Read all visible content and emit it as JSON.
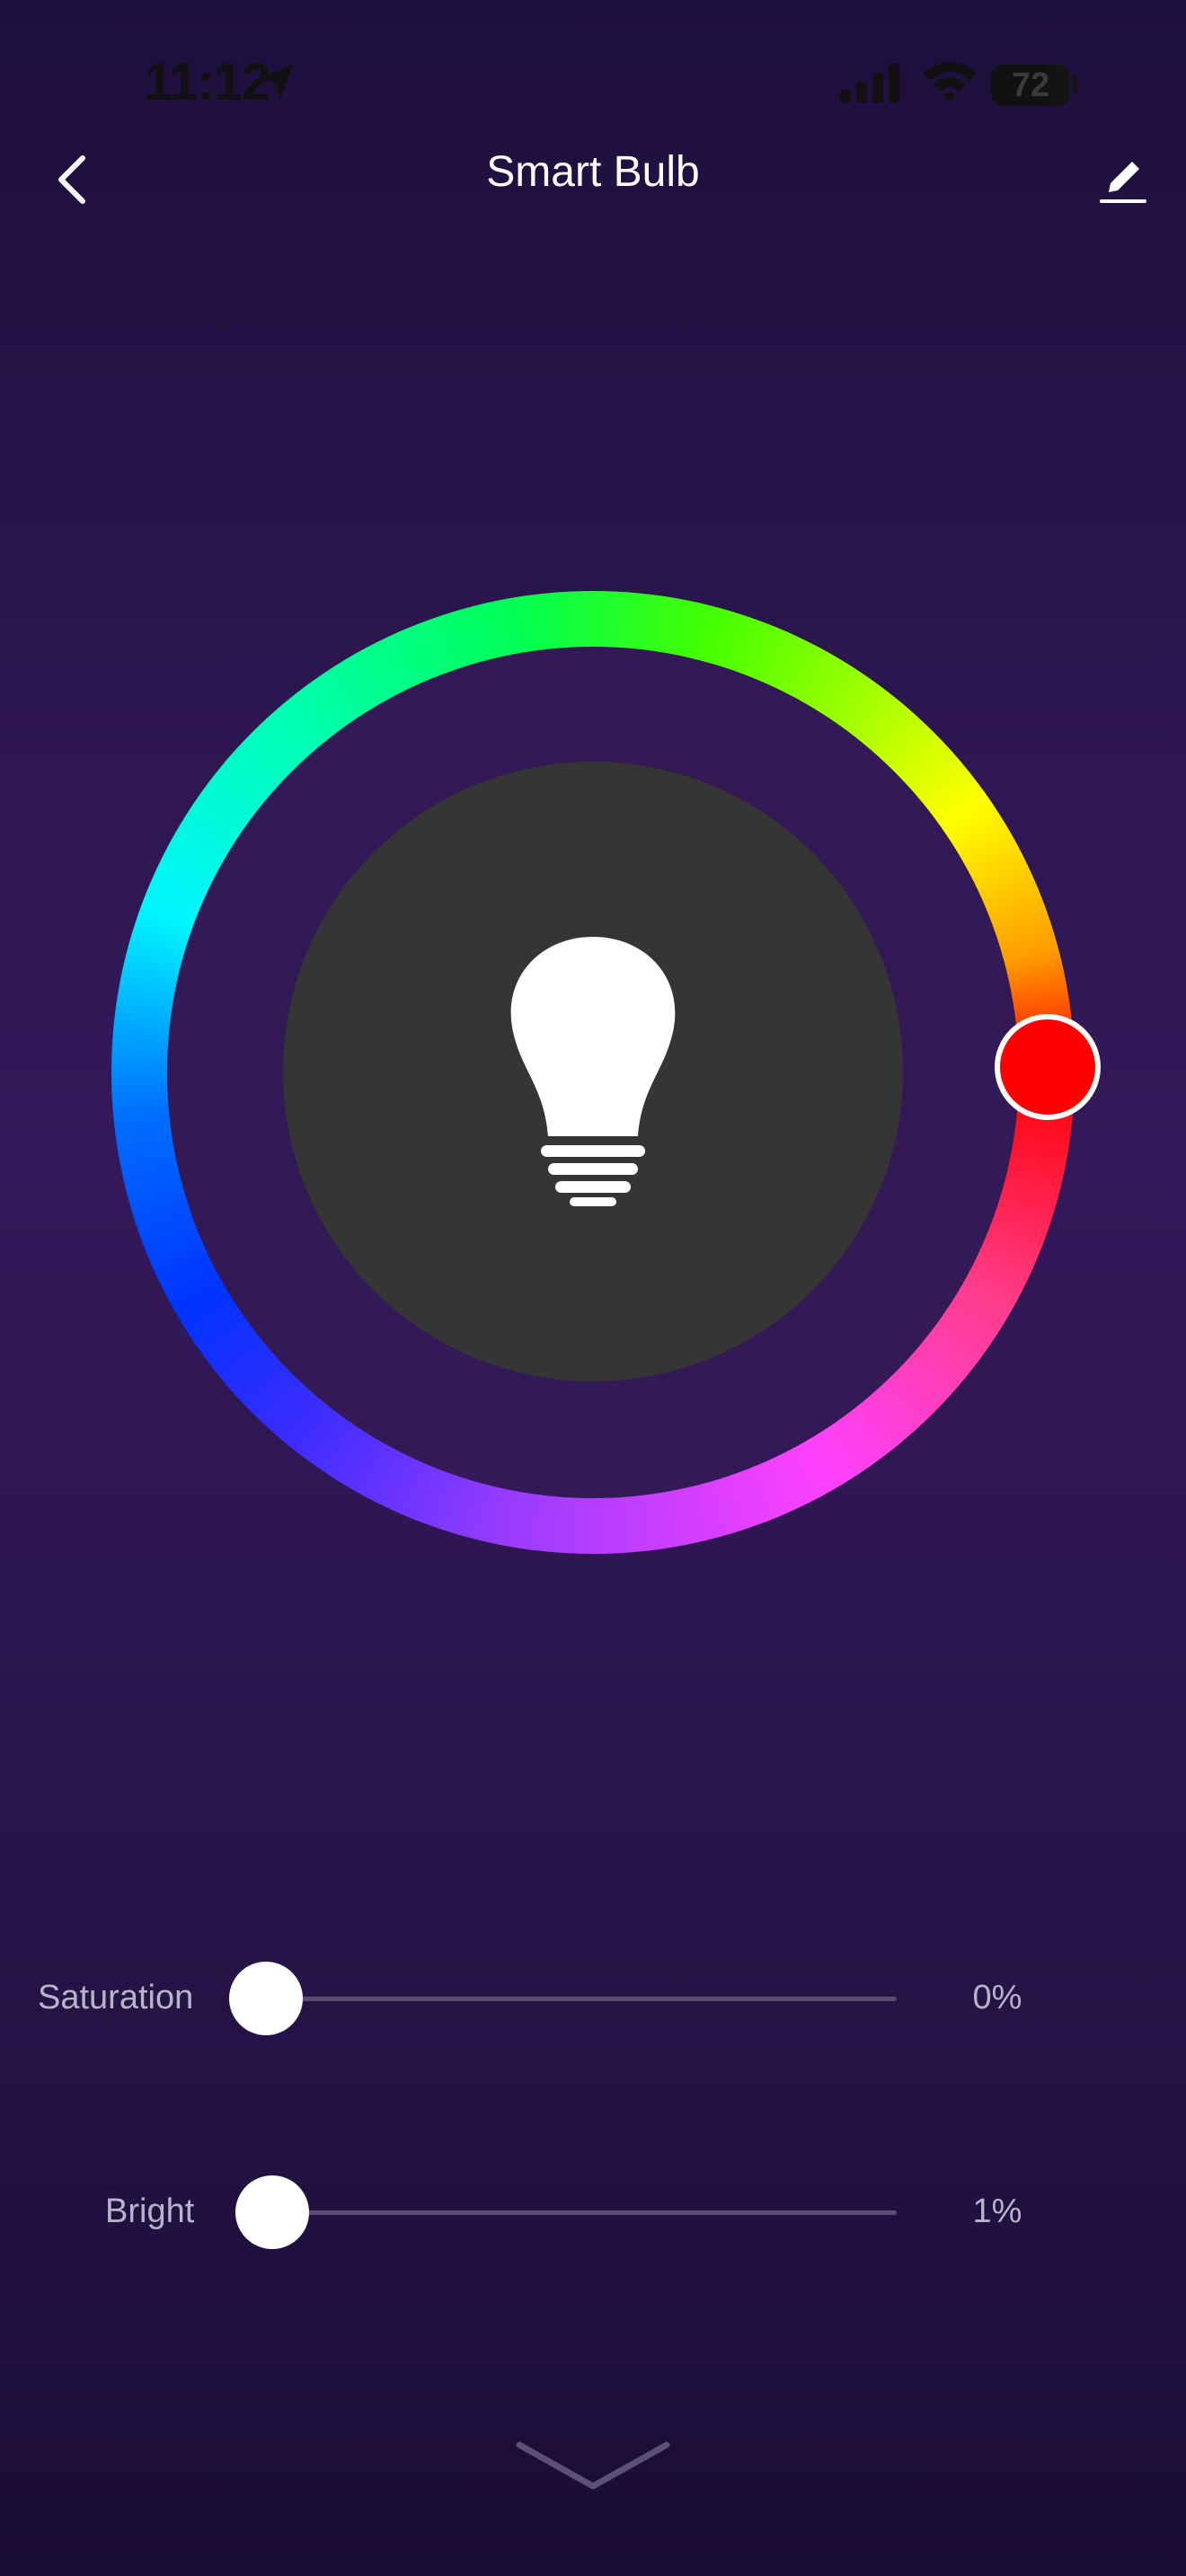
{
  "status_bar": {
    "time": "11:12",
    "battery": "72",
    "battery_level": 0.72,
    "icons": [
      "location-arrow-icon",
      "cellular-signal-icon",
      "wifi-icon",
      "battery-icon"
    ]
  },
  "header": {
    "title": "Smart Bulb",
    "back_icon": "chevron-left-icon",
    "edit_icon": "pencil-icon"
  },
  "color_wheel": {
    "selected_color": "#ff0000",
    "center_icon": "lightbulb-icon",
    "center_color": "#353535"
  },
  "sliders": [
    {
      "label": "Saturation",
      "value": "0%",
      "level": 0.0
    },
    {
      "label": "Bright",
      "value": "1%",
      "level": 0.01
    }
  ],
  "footer": {
    "collapse_icon": "chevron-down-icon"
  },
  "colors": {
    "background": "#2e1752",
    "thumb": "#ffffff",
    "track": "#5b4c72",
    "label_text": "#b9b2c8"
  }
}
